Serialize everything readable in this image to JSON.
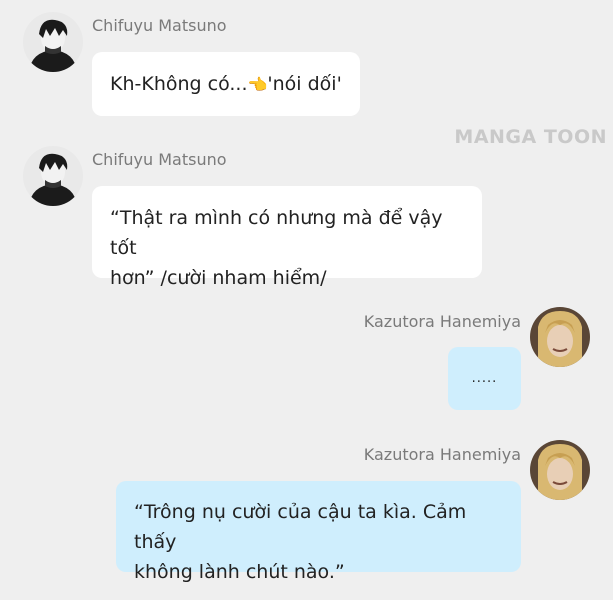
{
  "watermark": "MANGA TOON",
  "messages": [
    {
      "sender": "Chifuyu Matsuno",
      "text_before": "Kh-Không có...",
      "emoji": "👈",
      "text_after": "'nói dối'"
    },
    {
      "sender": "Chifuyu Matsuno",
      "line1": "“Thật ra mình có nhưng mà để vậy tốt",
      "line2": "hơn” /cười nham hiểm/"
    },
    {
      "sender": "Kazutora Hanemiya",
      "text": "....."
    },
    {
      "sender": "Kazutora Hanemiya",
      "line1": "“Trông nụ cười của cậu ta kìa. Cảm thấy",
      "line2": "không lành chút nào.”"
    }
  ],
  "colors": {
    "background": "#efefef",
    "left_bubble": "#ffffff",
    "right_bubble": "#cfeefd",
    "sender_name": "#7a7a7a"
  },
  "icons": {
    "left_avatar": "avatar-chifuyu-icon",
    "right_avatar": "avatar-kazutora-icon",
    "emoji": "backhand-index-pointing-left-icon"
  }
}
